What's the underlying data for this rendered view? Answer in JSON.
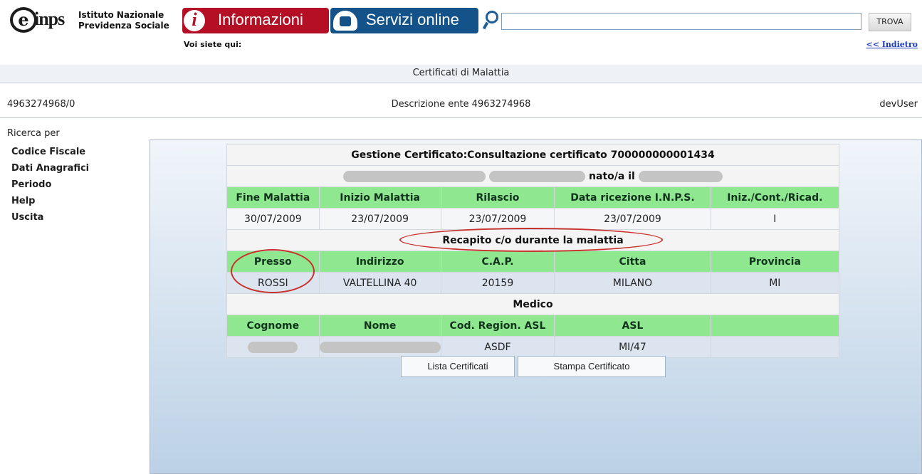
{
  "header": {
    "logo_text": "inps",
    "institute_line1": "Istituto Nazionale",
    "institute_line2": "Previdenza Sociale",
    "tab_info_label": "Informazioni",
    "tab_services_label": "Servizi online",
    "search_value": "",
    "search_button": "TROVA",
    "breadcrumb_label": "Voi siete qui:",
    "back_link": "<< Indietro"
  },
  "title_band": "Certificati di Malattia",
  "info_band": {
    "code": "4963274968/0",
    "description": "Descrizione ente 4963274968",
    "user": "devUser"
  },
  "sidebar": {
    "heading": "Ricerca per",
    "items": [
      {
        "label": "Codice Fiscale"
      },
      {
        "label": "Dati Anagrafici"
      },
      {
        "label": "Periodo"
      },
      {
        "label": "Help"
      },
      {
        "label": "Uscita"
      }
    ]
  },
  "certificate": {
    "title": "Gestione Certificato:Consultazione certificato 700000000001434",
    "birth_label": "nato/a il",
    "dates_headers": [
      "Fine Malattia",
      "Inizio Malattia",
      "Rilascio",
      "Data ricezione I.N.P.S.",
      "Iniz./Cont./Ricad."
    ],
    "dates_values": [
      "30/07/2009",
      "23/07/2009",
      "23/07/2009",
      "23/07/2009",
      "I"
    ],
    "recapito_title": "Recapito c/o durante la malattia",
    "recapito_headers": [
      "Presso",
      "Indirizzo",
      "C.A.P.",
      "Citta",
      "Provincia"
    ],
    "recapito_values": [
      "ROSSI",
      "VALTELLINA 40",
      "20159",
      "MILANO",
      "MI"
    ],
    "medico_title": "Medico",
    "medico_headers": [
      "Cognome",
      "Nome",
      "Cod. Region. ASL",
      "ASL",
      ""
    ],
    "medico_values": [
      "",
      "",
      "ASDF",
      "MI/47",
      ""
    ]
  },
  "buttons": {
    "list": "Lista Certificati",
    "print": "Stampa Certificato"
  },
  "colors": {
    "info_tab": "#b40f25",
    "services_tab": "#14538a",
    "header_row_green": "#8fe88f",
    "highlight_ellipse": "#c9302c"
  }
}
